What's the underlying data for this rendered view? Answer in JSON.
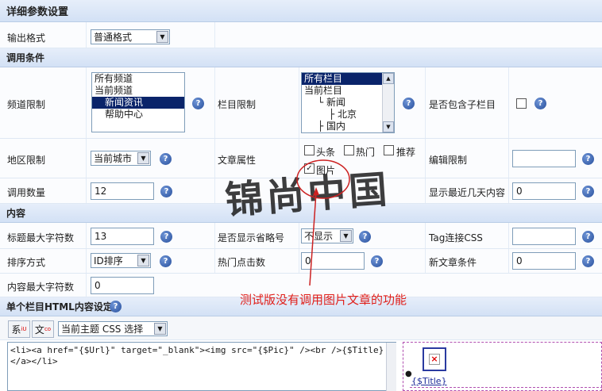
{
  "title": "详细参数设置",
  "output": {
    "label": "输出格式",
    "value": "普通格式"
  },
  "section_call": "调用条件",
  "channel": {
    "label": "频道限制",
    "options": [
      "所有频道",
      "当前频道",
      "新闻资讯",
      "帮助中心"
    ],
    "selected_index": 2
  },
  "column": {
    "label": "栏目限制",
    "options": [
      "所有栏目",
      "当前栏目",
      "└ 新闻",
      "├ 北京",
      "├ 国内"
    ],
    "selected_index": 0
  },
  "include_sub": {
    "label": "是否包含子栏目"
  },
  "region": {
    "label": "地区限制",
    "value": "当前城市"
  },
  "article_attr": {
    "label": "文章属性",
    "options": [
      "头条",
      "热门",
      "推荐",
      "图片"
    ],
    "checked": "图片"
  },
  "editor_limit": {
    "label": "编辑限制",
    "value": ""
  },
  "call_count": {
    "label": "调用数量",
    "value": "12"
  },
  "recent_days": {
    "label": "显示最近几天内容",
    "value": "0"
  },
  "section_content": "内容",
  "title_max": {
    "label": "标题最大字符数",
    "value": "13"
  },
  "show_ellipsis": {
    "label": "是否显示省略号",
    "value": "不显示"
  },
  "tag_css": {
    "label": "Tag连接CSS",
    "value": ""
  },
  "sort": {
    "label": "排序方式",
    "value": "ID排序"
  },
  "hot_clicks": {
    "label": "热门点击数",
    "value": "0"
  },
  "new_article": {
    "label": "新文章条件",
    "value": "0"
  },
  "content_max": {
    "label": "内容最大字符数",
    "value": "0"
  },
  "section_html": "单个栏目HTML内容设定",
  "toolbar": {
    "btn1": "系",
    "btn2": "文",
    "theme_select": "当前主题 CSS 选择"
  },
  "template_code": "<li><a href=\"{$Url}\" target=\"_blank\"><img src=\"{$Pic}\" /><br />{$Title}</a></li>",
  "preview": {
    "title_token": "{$Title}"
  },
  "watermark": "锦尚中国",
  "annotation": "测试版没有调用图片文章的功能",
  "help_glyph": "?",
  "colors": {
    "header": "#d3e1f5",
    "selected": "#0a246a",
    "annotation": "#e0201b",
    "circle": "#cc2222"
  }
}
